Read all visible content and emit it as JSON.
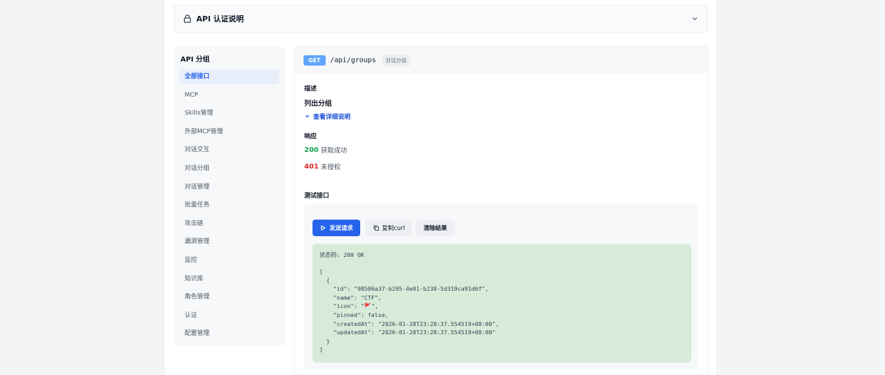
{
  "auth": {
    "title": "API 认证说明",
    "lock_icon": "lock-icon",
    "chevron_icon": "chevron-down-icon"
  },
  "sidebar": {
    "heading": "API 分组",
    "items": [
      {
        "label": "全部接口",
        "active": true
      },
      {
        "label": "MCP"
      },
      {
        "label": "Skills管理"
      },
      {
        "label": "外部MCP管理"
      },
      {
        "label": "对话交互"
      },
      {
        "label": "对话分组"
      },
      {
        "label": "对话管理"
      },
      {
        "label": "批量任务"
      },
      {
        "label": "攻击链"
      },
      {
        "label": "漏洞管理"
      },
      {
        "label": "监控"
      },
      {
        "label": "知识库"
      },
      {
        "label": "角色管理"
      },
      {
        "label": "认证"
      },
      {
        "label": "配置管理"
      }
    ]
  },
  "endpoint": {
    "method": "GET",
    "path": "/api/groups",
    "tag": "对话分组",
    "method_color": "#60a5fa"
  },
  "description": {
    "label": "描述",
    "text": "列出分组",
    "detail_link": "查看详细说明"
  },
  "responses": {
    "label": "响应",
    "items": [
      {
        "code": "200",
        "text": "获取成功",
        "color": "#16a34a"
      },
      {
        "code": "401",
        "text": "未授权",
        "color": "#dc2626"
      }
    ]
  },
  "test": {
    "label": "测试接口",
    "send_label": "发送请求",
    "copy_label": "复制curl",
    "clear_label": "清除结果",
    "status": "状态码: 200 OK",
    "body": "[\n  {\n    \"id\": \"98506a37-b295-4e01-b238-5d319ca91d6f\",\n    \"name\": \"CTF\",\n    \"icon\": \"🚩\",\n    \"pinned\": false,\n    \"createdAt\": \"2026-01-28T23:28:37.554519+08:00\",\n    \"updatedAt\": \"2026-01-28T23:28:37.554519+08:00\"\n  }\n]"
  },
  "colors": {
    "accent": "#2563eb",
    "success_bg": "#d6ecd9"
  }
}
